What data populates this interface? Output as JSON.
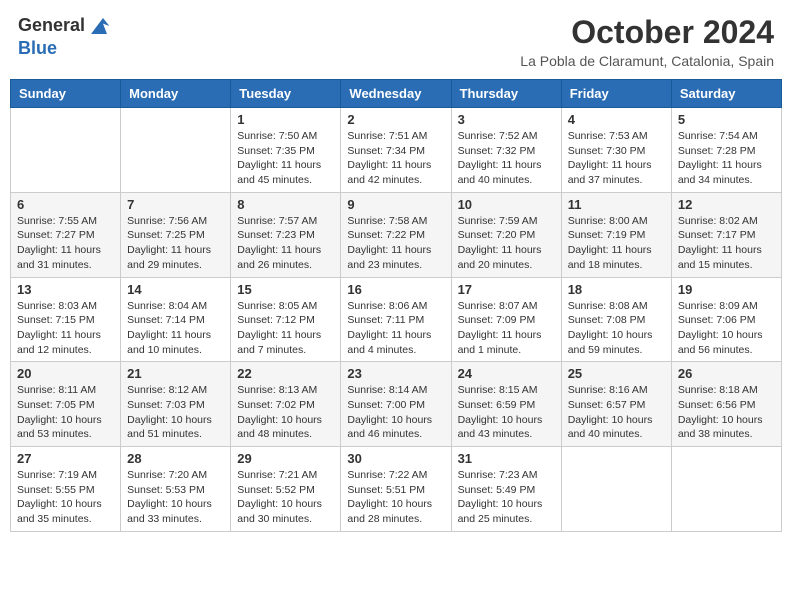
{
  "header": {
    "logo_line1": "General",
    "logo_line2": "Blue",
    "month_year": "October 2024",
    "location": "La Pobla de Claramunt, Catalonia, Spain"
  },
  "weekdays": [
    "Sunday",
    "Monday",
    "Tuesday",
    "Wednesday",
    "Thursday",
    "Friday",
    "Saturday"
  ],
  "weeks": [
    [
      {
        "day": "",
        "sunrise": "",
        "sunset": "",
        "daylight": ""
      },
      {
        "day": "",
        "sunrise": "",
        "sunset": "",
        "daylight": ""
      },
      {
        "day": "1",
        "sunrise": "Sunrise: 7:50 AM",
        "sunset": "Sunset: 7:35 PM",
        "daylight": "Daylight: 11 hours and 45 minutes."
      },
      {
        "day": "2",
        "sunrise": "Sunrise: 7:51 AM",
        "sunset": "Sunset: 7:34 PM",
        "daylight": "Daylight: 11 hours and 42 minutes."
      },
      {
        "day": "3",
        "sunrise": "Sunrise: 7:52 AM",
        "sunset": "Sunset: 7:32 PM",
        "daylight": "Daylight: 11 hours and 40 minutes."
      },
      {
        "day": "4",
        "sunrise": "Sunrise: 7:53 AM",
        "sunset": "Sunset: 7:30 PM",
        "daylight": "Daylight: 11 hours and 37 minutes."
      },
      {
        "day": "5",
        "sunrise": "Sunrise: 7:54 AM",
        "sunset": "Sunset: 7:28 PM",
        "daylight": "Daylight: 11 hours and 34 minutes."
      }
    ],
    [
      {
        "day": "6",
        "sunrise": "Sunrise: 7:55 AM",
        "sunset": "Sunset: 7:27 PM",
        "daylight": "Daylight: 11 hours and 31 minutes."
      },
      {
        "day": "7",
        "sunrise": "Sunrise: 7:56 AM",
        "sunset": "Sunset: 7:25 PM",
        "daylight": "Daylight: 11 hours and 29 minutes."
      },
      {
        "day": "8",
        "sunrise": "Sunrise: 7:57 AM",
        "sunset": "Sunset: 7:23 PM",
        "daylight": "Daylight: 11 hours and 26 minutes."
      },
      {
        "day": "9",
        "sunrise": "Sunrise: 7:58 AM",
        "sunset": "Sunset: 7:22 PM",
        "daylight": "Daylight: 11 hours and 23 minutes."
      },
      {
        "day": "10",
        "sunrise": "Sunrise: 7:59 AM",
        "sunset": "Sunset: 7:20 PM",
        "daylight": "Daylight: 11 hours and 20 minutes."
      },
      {
        "day": "11",
        "sunrise": "Sunrise: 8:00 AM",
        "sunset": "Sunset: 7:19 PM",
        "daylight": "Daylight: 11 hours and 18 minutes."
      },
      {
        "day": "12",
        "sunrise": "Sunrise: 8:02 AM",
        "sunset": "Sunset: 7:17 PM",
        "daylight": "Daylight: 11 hours and 15 minutes."
      }
    ],
    [
      {
        "day": "13",
        "sunrise": "Sunrise: 8:03 AM",
        "sunset": "Sunset: 7:15 PM",
        "daylight": "Daylight: 11 hours and 12 minutes."
      },
      {
        "day": "14",
        "sunrise": "Sunrise: 8:04 AM",
        "sunset": "Sunset: 7:14 PM",
        "daylight": "Daylight: 11 hours and 10 minutes."
      },
      {
        "day": "15",
        "sunrise": "Sunrise: 8:05 AM",
        "sunset": "Sunset: 7:12 PM",
        "daylight": "Daylight: 11 hours and 7 minutes."
      },
      {
        "day": "16",
        "sunrise": "Sunrise: 8:06 AM",
        "sunset": "Sunset: 7:11 PM",
        "daylight": "Daylight: 11 hours and 4 minutes."
      },
      {
        "day": "17",
        "sunrise": "Sunrise: 8:07 AM",
        "sunset": "Sunset: 7:09 PM",
        "daylight": "Daylight: 11 hours and 1 minute."
      },
      {
        "day": "18",
        "sunrise": "Sunrise: 8:08 AM",
        "sunset": "Sunset: 7:08 PM",
        "daylight": "Daylight: 10 hours and 59 minutes."
      },
      {
        "day": "19",
        "sunrise": "Sunrise: 8:09 AM",
        "sunset": "Sunset: 7:06 PM",
        "daylight": "Daylight: 10 hours and 56 minutes."
      }
    ],
    [
      {
        "day": "20",
        "sunrise": "Sunrise: 8:11 AM",
        "sunset": "Sunset: 7:05 PM",
        "daylight": "Daylight: 10 hours and 53 minutes."
      },
      {
        "day": "21",
        "sunrise": "Sunrise: 8:12 AM",
        "sunset": "Sunset: 7:03 PM",
        "daylight": "Daylight: 10 hours and 51 minutes."
      },
      {
        "day": "22",
        "sunrise": "Sunrise: 8:13 AM",
        "sunset": "Sunset: 7:02 PM",
        "daylight": "Daylight: 10 hours and 48 minutes."
      },
      {
        "day": "23",
        "sunrise": "Sunrise: 8:14 AM",
        "sunset": "Sunset: 7:00 PM",
        "daylight": "Daylight: 10 hours and 46 minutes."
      },
      {
        "day": "24",
        "sunrise": "Sunrise: 8:15 AM",
        "sunset": "Sunset: 6:59 PM",
        "daylight": "Daylight: 10 hours and 43 minutes."
      },
      {
        "day": "25",
        "sunrise": "Sunrise: 8:16 AM",
        "sunset": "Sunset: 6:57 PM",
        "daylight": "Daylight: 10 hours and 40 minutes."
      },
      {
        "day": "26",
        "sunrise": "Sunrise: 8:18 AM",
        "sunset": "Sunset: 6:56 PM",
        "daylight": "Daylight: 10 hours and 38 minutes."
      }
    ],
    [
      {
        "day": "27",
        "sunrise": "Sunrise: 7:19 AM",
        "sunset": "Sunset: 5:55 PM",
        "daylight": "Daylight: 10 hours and 35 minutes."
      },
      {
        "day": "28",
        "sunrise": "Sunrise: 7:20 AM",
        "sunset": "Sunset: 5:53 PM",
        "daylight": "Daylight: 10 hours and 33 minutes."
      },
      {
        "day": "29",
        "sunrise": "Sunrise: 7:21 AM",
        "sunset": "Sunset: 5:52 PM",
        "daylight": "Daylight: 10 hours and 30 minutes."
      },
      {
        "day": "30",
        "sunrise": "Sunrise: 7:22 AM",
        "sunset": "Sunset: 5:51 PM",
        "daylight": "Daylight: 10 hours and 28 minutes."
      },
      {
        "day": "31",
        "sunrise": "Sunrise: 7:23 AM",
        "sunset": "Sunset: 5:49 PM",
        "daylight": "Daylight: 10 hours and 25 minutes."
      },
      {
        "day": "",
        "sunrise": "",
        "sunset": "",
        "daylight": ""
      },
      {
        "day": "",
        "sunrise": "",
        "sunset": "",
        "daylight": ""
      }
    ]
  ]
}
